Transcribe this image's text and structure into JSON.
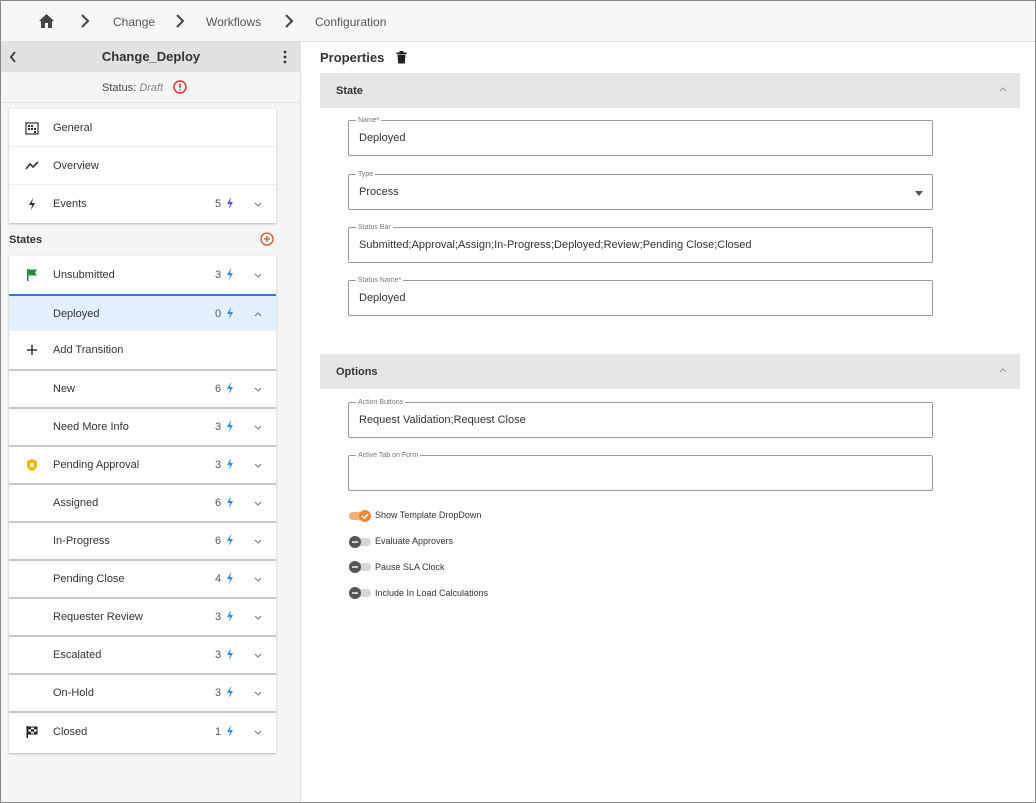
{
  "breadcrumb": {
    "home_icon": "home-icon",
    "items": [
      "Change",
      "Workflows",
      "Configuration"
    ]
  },
  "workflow": {
    "title": "Change_Deploy",
    "status_label": "Status:",
    "status_value": "Draft"
  },
  "general_items": [
    {
      "label": "General",
      "icon": "building-icon"
    },
    {
      "label": "Overview",
      "icon": "trend-line-icon"
    },
    {
      "label": "Events",
      "icon": "bolt-icon",
      "count": "5"
    }
  ],
  "states_label": "States",
  "states": [
    {
      "label": "Unsubmitted",
      "count": "3",
      "icon": "green-flag-icon"
    },
    {
      "label": "Deployed",
      "count": "0",
      "selected": true
    },
    {
      "label": "New",
      "count": "6"
    },
    {
      "label": "Need More Info",
      "count": "3"
    },
    {
      "label": "Pending Approval",
      "count": "3",
      "icon": "approval-badge-icon"
    },
    {
      "label": "Assigned",
      "count": "6"
    },
    {
      "label": "In-Progress",
      "count": "6"
    },
    {
      "label": "Pending Close",
      "count": "4"
    },
    {
      "label": "Requester Review",
      "count": "3"
    },
    {
      "label": "Escalated",
      "count": "3"
    },
    {
      "label": "On-Hold",
      "count": "3"
    },
    {
      "label": "Closed",
      "count": "1",
      "icon": "checkered-flag-icon"
    }
  ],
  "add_transition_label": "Add Transition",
  "properties": {
    "title": "Properties",
    "state_section": "State",
    "options_section": "Options",
    "fields": {
      "name": {
        "label": "Name*",
        "value": "Deployed"
      },
      "type": {
        "label": "Type",
        "value": "Process"
      },
      "status_bar": {
        "label": "Status Bar",
        "value": "Submitted;Approval;Assign;In-Progress;Deployed;Review;Pending Close;Closed"
      },
      "status_name": {
        "label": "Status Name*",
        "value": "Deployed"
      },
      "action_buttons": {
        "label": "Action Buttons",
        "value": "Request Validation;Request Close"
      },
      "active_tab": {
        "label": "Active Tab on Form",
        "value": ""
      }
    },
    "toggles": [
      {
        "label": "Show Template DropDown",
        "on": true
      },
      {
        "label": "Evaluate Approvers",
        "on": false
      },
      {
        "label": "Pause SLA Clock",
        "on": false
      },
      {
        "label": "Include In Load Calculations",
        "on": false
      }
    ]
  },
  "colors": {
    "accent_blue": "#2b7de9",
    "selected_bg": "#e3f0fd",
    "toggle_on": "#e8883a",
    "warn_red": "#d93025",
    "bolt_purple": "#6b4fd8",
    "bolt_blue": "#2b8ff0",
    "flag_green": "#1e8e3e",
    "badge_yellow": "#f5b400"
  }
}
